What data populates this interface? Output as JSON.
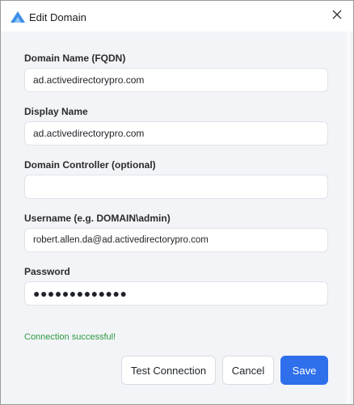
{
  "window": {
    "title": "Edit Domain"
  },
  "icons": {
    "app_logo": "app-logo-icon",
    "close": "close-icon"
  },
  "form": {
    "domain_name": {
      "label": "Domain Name (FQDN)",
      "value": "ad.activedirectorypro.com"
    },
    "display_name": {
      "label": "Display Name",
      "value": "ad.activedirectorypro.com"
    },
    "domain_controller": {
      "label": "Domain Controller (optional)",
      "value": ""
    },
    "username": {
      "label": "Username (e.g. DOMAIN\\admin)",
      "value": "robert.allen.da@ad.activedirectorypro.com"
    },
    "password": {
      "label": "Password",
      "value": "●●●●●●●●●●●●●"
    }
  },
  "status": {
    "message": "Connection successful!",
    "color": "#2c9a3e"
  },
  "buttons": {
    "test_connection": "Test Connection",
    "cancel": "Cancel",
    "save": "Save"
  },
  "colors": {
    "primary": "#2f6fec",
    "background": "#f3f4f8"
  }
}
